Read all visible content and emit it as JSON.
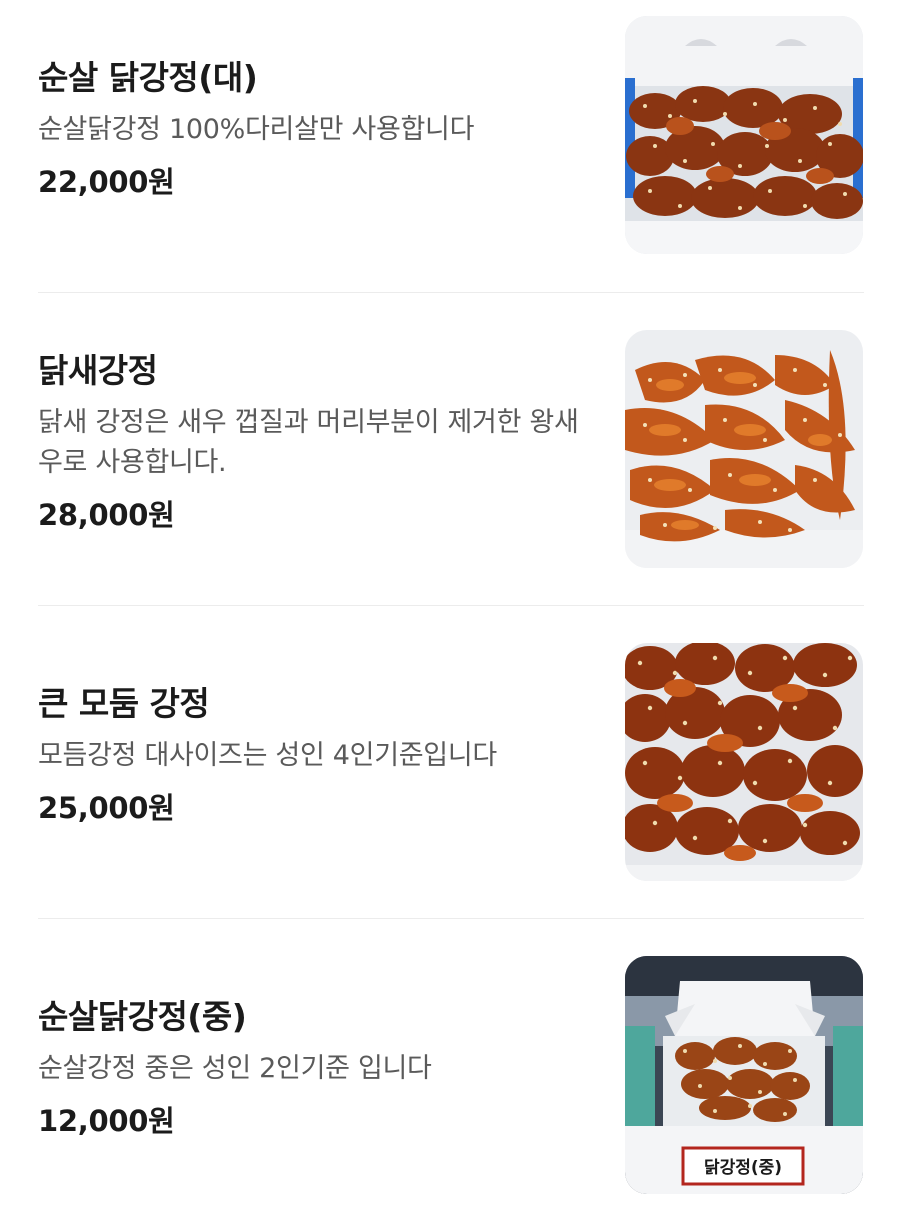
{
  "menu": {
    "items": [
      {
        "name": "순살 닭강정(대)",
        "desc": "순살닭강정 100%다리살만 사용합니다",
        "price": "22,000원",
        "image": "boneless-chicken-gangjeong-box-image"
      },
      {
        "name": "닭새강정",
        "desc": "닭새 강정은 새우 껍질과 머리부분이 제거한 왕새우로 사용합니다.",
        "price": "28,000원",
        "image": "shrimp-gangjeong-image"
      },
      {
        "name": "큰 모둠 강정",
        "desc": "모듬강정 대사이즈는 성인 4인기준입니다",
        "price": "25,000원",
        "image": "assorted-gangjeong-image"
      },
      {
        "name": "순살닭강정(중)",
        "desc": "순살강정 중은 성인 2인기준 입니다",
        "price": "12,000원",
        "image": "medium-gangjeong-box-image",
        "box_label": "닭강정(중)"
      }
    ]
  },
  "colors": {
    "sauce": "#c0561e",
    "dark_sauce": "#7a2e10",
    "box": "#eef1f5"
  }
}
